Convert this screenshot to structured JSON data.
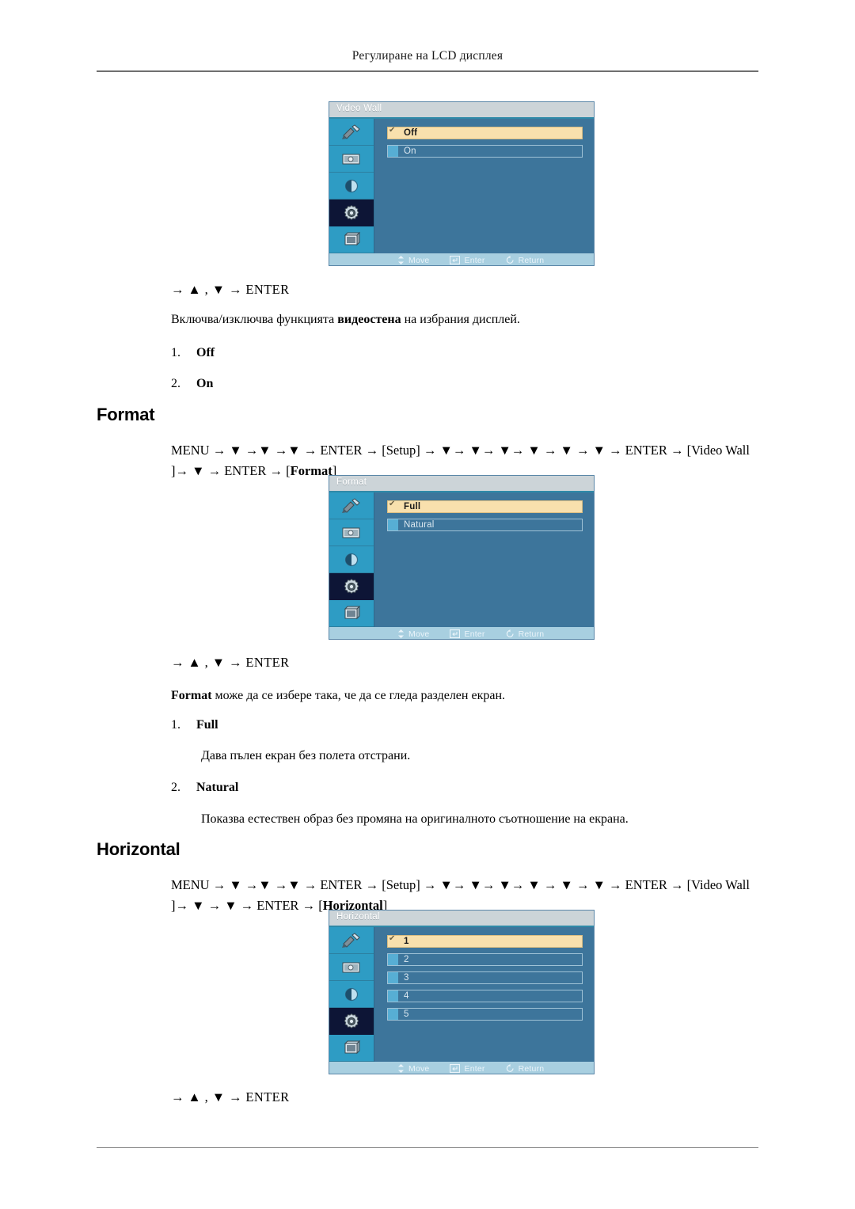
{
  "header": {
    "running_title": "Регулиране на LCD дисплея"
  },
  "osd_footer": {
    "move": "Move",
    "enter": "Enter",
    "return": "Return"
  },
  "sections": [
    {
      "id": "video-wall",
      "osd": {
        "title": "Video Wall",
        "rows": [
          {
            "label": "Off",
            "active": true
          },
          {
            "label": "On",
            "active": false
          }
        ]
      },
      "nav_line": "→ ▲ , ▼ → ENTER",
      "description_pre": "Включва/изключва функцията ",
      "description_bold": "видеостена",
      "description_post": " на избрания дисплей.",
      "options": [
        {
          "num": "1.",
          "label": "Off"
        },
        {
          "num": "2.",
          "label": "On"
        }
      ]
    },
    {
      "id": "format",
      "heading": "Format",
      "menu_path_line1": "MENU → ▼ →▼ →▼ → ENTER → [Setup] → ▼→ ▼→ ▼→ ▼ → ▼ → ▼ → ENTER → [Video",
      "menu_path_line2_a": "Wall ]→ ▼ → ENTER → [",
      "menu_path_line2_b": "Format",
      "menu_path_line2_c": "]",
      "osd": {
        "title": "Format",
        "rows": [
          {
            "label": "Full",
            "active": true
          },
          {
            "label": "Natural",
            "active": false
          }
        ]
      },
      "nav_line": "→ ▲ , ▼ → ENTER",
      "description_bold": "Format",
      "description_post": " може да се избере така, че да се гледа разделен екран.",
      "options": [
        {
          "num": "1.",
          "label": "Full",
          "desc": "Дава пълен екран без полета отстрани."
        },
        {
          "num": "2.",
          "label": "Natural",
          "desc": "Показва естествен образ без промяна на оригиналното съотношение на екрана."
        }
      ]
    },
    {
      "id": "horizontal",
      "heading": "Horizontal",
      "menu_path_line1": "MENU → ▼ →▼ →▼ → ENTER → [Setup] → ▼→ ▼→ ▼→ ▼ → ▼ → ▼ → ENTER → [Video",
      "menu_path_line2_a": "Wall ]→ ▼ → ▼ → ENTER → [",
      "menu_path_line2_b": "Horizontal",
      "menu_path_line2_c": "]",
      "osd": {
        "title": "Horizontal",
        "rows": [
          {
            "label": "1",
            "active": true
          },
          {
            "label": "2",
            "active": false
          },
          {
            "label": "3",
            "active": false
          },
          {
            "label": "4",
            "active": false
          },
          {
            "label": "5",
            "active": false
          }
        ]
      },
      "nav_line": "→ ▲ , ▼ → ENTER"
    }
  ],
  "colors": {
    "osd_body": "#3d759b",
    "osd_sidebar": "#2e9cc4",
    "osd_sidebar_selected": "#0d1536",
    "osd_title_bar": "#ccd4d8",
    "osd_footer_bar": "#a8cfe0",
    "row_active": "#f8e0ad",
    "chip": "#57aed4"
  }
}
